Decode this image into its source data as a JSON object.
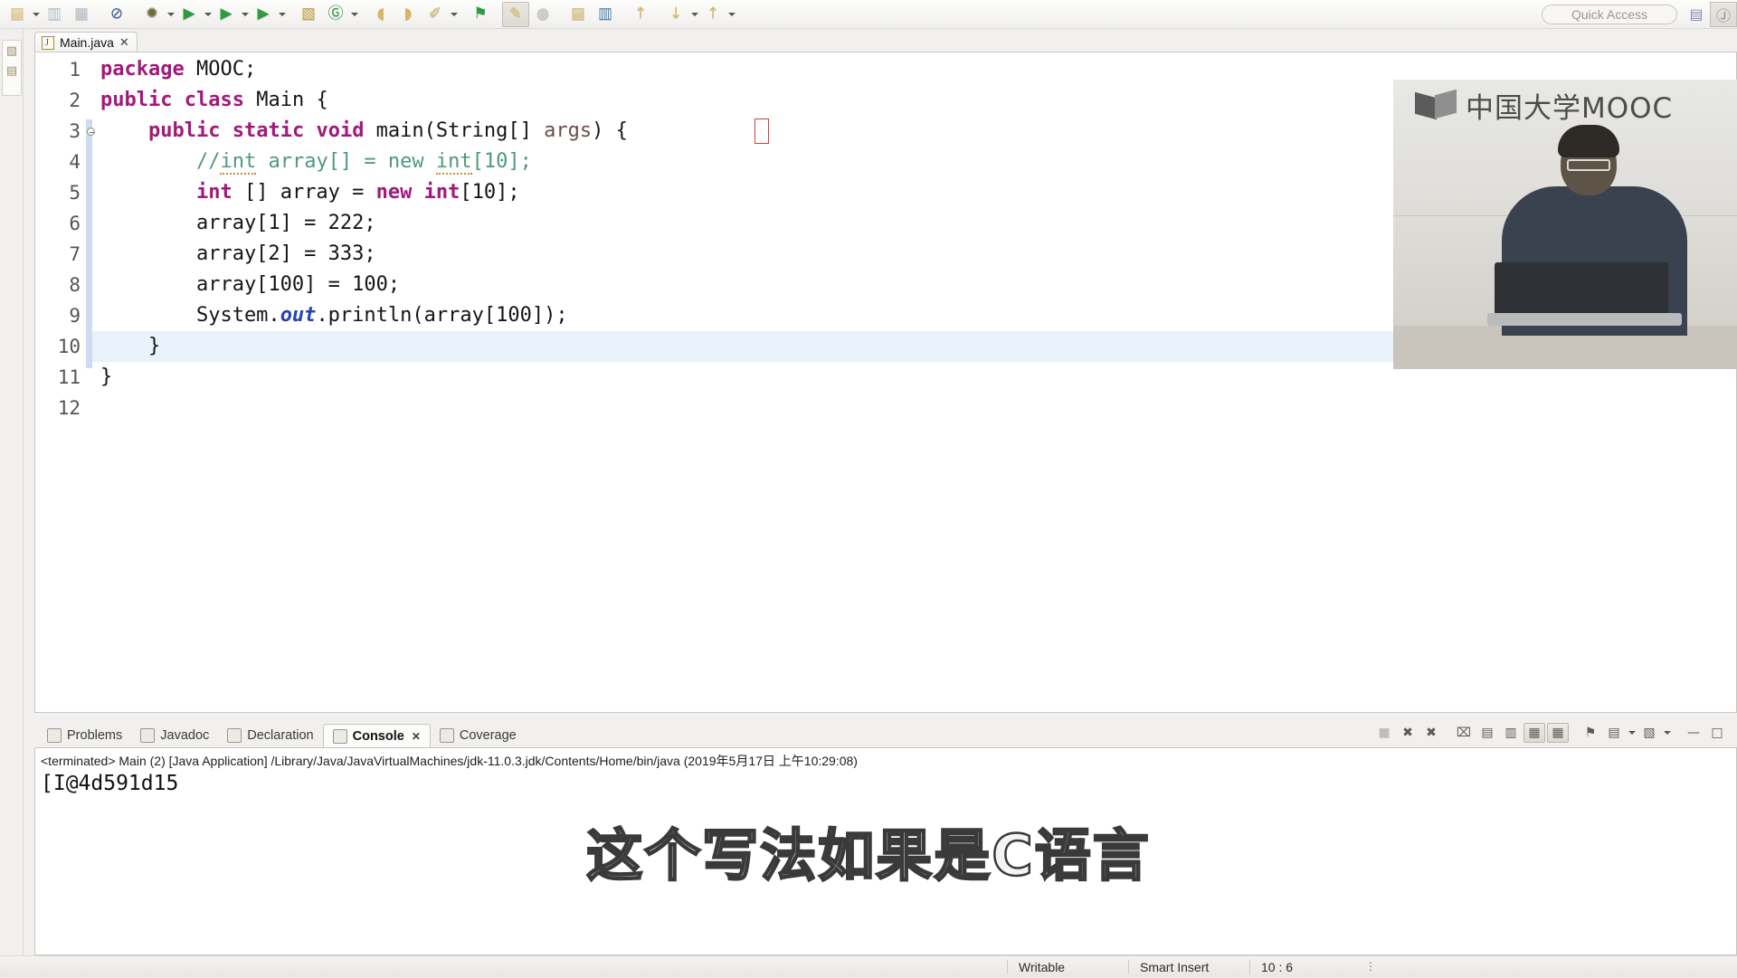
{
  "toolbar": {
    "quick_access_placeholder": "Quick Access",
    "buttons": [
      {
        "name": "new-wizard",
        "glyph": "▤",
        "color": "#e9c36a",
        "dropdown": true
      },
      {
        "name": "save",
        "glyph": "▥",
        "color": "#b9c4cc",
        "dropdown": false
      },
      {
        "name": "save-all",
        "glyph": "▦",
        "color": "#b9c4cc",
        "dropdown": false
      },
      {
        "name": "skip-all-breakpoints",
        "glyph": "⊘",
        "color": "#3a5f9e",
        "dropdown": false
      },
      {
        "name": "debug",
        "glyph": "✹",
        "color": "#6f6f3a",
        "dropdown": true
      },
      {
        "name": "run",
        "glyph": "▶",
        "color": "#2e9b3e",
        "dropdown": true
      },
      {
        "name": "run-coverage",
        "glyph": "▶",
        "color": "#2e9b3e",
        "dropdown": true
      },
      {
        "name": "run-last-tool",
        "glyph": "▶",
        "color": "#2e9b3e",
        "dropdown": true
      },
      {
        "name": "new-java-package",
        "glyph": "▧",
        "color": "#c5a33e",
        "dropdown": false
      },
      {
        "name": "new-java-class",
        "glyph": "Ⓖ",
        "color": "#2e9b3e",
        "dropdown": true
      },
      {
        "name": "open-type",
        "glyph": "◖",
        "color": "#d8b760",
        "dropdown": false
      },
      {
        "name": "open-task",
        "glyph": "◗",
        "color": "#d8b760",
        "dropdown": false
      },
      {
        "name": "search",
        "glyph": "✐",
        "color": "#d8b760",
        "dropdown": true
      },
      {
        "name": "toggle-mark-occurrences",
        "glyph": "⚑",
        "color": "#2e9b3e",
        "dropdown": false
      },
      {
        "name": "pin-editor",
        "glyph": "✎",
        "color": "#e0c469",
        "dropdown": false,
        "pressed": true
      },
      {
        "name": "external-tools",
        "glyph": "●",
        "color": "#cdcdc8",
        "dropdown": false
      },
      {
        "name": "next-annotation",
        "glyph": "▤",
        "color": "#d8b760",
        "dropdown": false
      },
      {
        "name": "previous-annotation",
        "glyph": "▥",
        "color": "#4f7fb5",
        "dropdown": false
      },
      {
        "name": "last-edit-location",
        "glyph": "↑",
        "color": "#d8b760",
        "dropdown": false
      },
      {
        "name": "back",
        "glyph": "↓",
        "color": "#d8b760",
        "dropdown": true
      },
      {
        "name": "forward",
        "glyph": "↑",
        "color": "#d8b760",
        "dropdown": true
      }
    ],
    "perspective_buttons": [
      {
        "name": "open-perspective",
        "glyph": "▤"
      },
      {
        "name": "java-perspective",
        "glyph": "Ⓙ",
        "active": true
      }
    ]
  },
  "left_rail": {
    "items": [
      {
        "name": "restore-view",
        "glyph": "▧"
      },
      {
        "name": "package-explorer-view",
        "glyph": "▤"
      }
    ]
  },
  "editor": {
    "tab": {
      "label": "Main.java",
      "icon": "java-file-icon",
      "close_glyph": "✕"
    },
    "current_line": 10,
    "lines": [
      {
        "num": "1",
        "indent": 0,
        "folder": false,
        "html": "<span class='kw'>package</span> MOOC;"
      },
      {
        "num": "2",
        "indent": 0,
        "folder": false,
        "html": "<span class='kw'>public</span> <span class='kw'>class</span> Main {"
      },
      {
        "num": "3",
        "indent": 0,
        "folder": true,
        "html": "    <span class='kw'>public</span> <span class='kw'>static</span> <span class='kw'>void</span> main(String[] <span style='color:#6f4b4b'>args</span>) {"
      },
      {
        "num": "4",
        "indent": 0,
        "folder": false,
        "html": "        <span class='cm'>//<u>int</u> array[] = new <u>int</u>[10];</span>"
      },
      {
        "num": "5",
        "indent": 0,
        "folder": false,
        "html": "        <span class='kw'>int</span> [] array = <span class='kw'>new</span> <span class='kw'>int</span>[10];"
      },
      {
        "num": "6",
        "indent": 0,
        "folder": false,
        "html": "        array[1] = 222;"
      },
      {
        "num": "7",
        "indent": 0,
        "folder": false,
        "html": "        array[2] = 333;"
      },
      {
        "num": "8",
        "indent": 0,
        "folder": false,
        "html": "        array[100] = 100;"
      },
      {
        "num": "9",
        "indent": 0,
        "folder": false,
        "html": "        System.<span class='fld'>out</span>.println(array[100]);"
      },
      {
        "num": "10",
        "indent": 0,
        "folder": false,
        "html": "    }"
      },
      {
        "num": "11",
        "indent": 0,
        "folder": false,
        "html": "}"
      },
      {
        "num": "12",
        "indent": 0,
        "folder": false,
        "html": ""
      }
    ],
    "plain_code": "package MOOC;\npublic class Main {\n    public static void main(String[] args) {\n        //int array[] = new int[10];\n        int [] array = new int[10];\n        array[1] = 222;\n        array[2] = 333;\n        array[100] = 100;\n        System.out.println(array[100]);\n    }\n}\n"
  },
  "video_overlay": {
    "logo_text": "中国大学MOOC",
    "logo_icon": "mooc-book-icon"
  },
  "console": {
    "tabs": [
      {
        "label": "Problems",
        "icon": "problems-icon",
        "active": false
      },
      {
        "label": "Javadoc",
        "icon": "javadoc-icon",
        "active": false
      },
      {
        "label": "Declaration",
        "icon": "declaration-icon",
        "active": false
      },
      {
        "label": "Console",
        "icon": "console-icon",
        "active": true,
        "close_glyph": "✕"
      },
      {
        "label": "Coverage",
        "icon": "coverage-icon",
        "active": false
      }
    ],
    "tools": [
      {
        "name": "terminate",
        "glyph": "■",
        "state": "disabled"
      },
      {
        "name": "remove-launch",
        "glyph": "✖",
        "state": "normal"
      },
      {
        "name": "remove-all-terminated",
        "glyph": "✖",
        "state": "normal"
      },
      {
        "name": "clear-console",
        "glyph": "⌧",
        "state": "normal"
      },
      {
        "name": "scroll-lock",
        "glyph": "▤",
        "state": "normal"
      },
      {
        "name": "word-wrap",
        "glyph": "▥",
        "state": "normal"
      },
      {
        "name": "show-console-on-output",
        "glyph": "▦",
        "state": "on"
      },
      {
        "name": "show-console-on-error",
        "glyph": "▦",
        "state": "on"
      },
      {
        "name": "pin-console",
        "glyph": "⚑",
        "state": "normal"
      },
      {
        "name": "display-selected-console",
        "glyph": "▤",
        "state": "normal",
        "dropdown": true
      },
      {
        "name": "open-console",
        "glyph": "▧",
        "state": "normal",
        "dropdown": true
      },
      {
        "name": "minimize",
        "glyph": "—",
        "state": "normal"
      },
      {
        "name": "maximize",
        "glyph": "□",
        "state": "normal"
      }
    ],
    "terminated_line": "<terminated> Main (2) [Java Application] /Library/Java/JavaVirtualMachines/jdk-11.0.3.jdk/Contents/Home/bin/java (2019年5月17日 上午10:29:08)",
    "output": "[I@4d591d15"
  },
  "subtitle": {
    "text": "这个写法如果是C语言"
  },
  "status_bar": {
    "writable": "Writable",
    "insert_mode": "Smart Insert",
    "cursor_position": "10 : 6",
    "menu_glyph": "⋮"
  },
  "colors": {
    "keyword": "#a3187a",
    "comment": "#4f9a79",
    "field": "#2642b5",
    "selection": "#e9f1fb",
    "bracket_outline": "#d03f3f",
    "chrome": "#f1f0ee"
  }
}
